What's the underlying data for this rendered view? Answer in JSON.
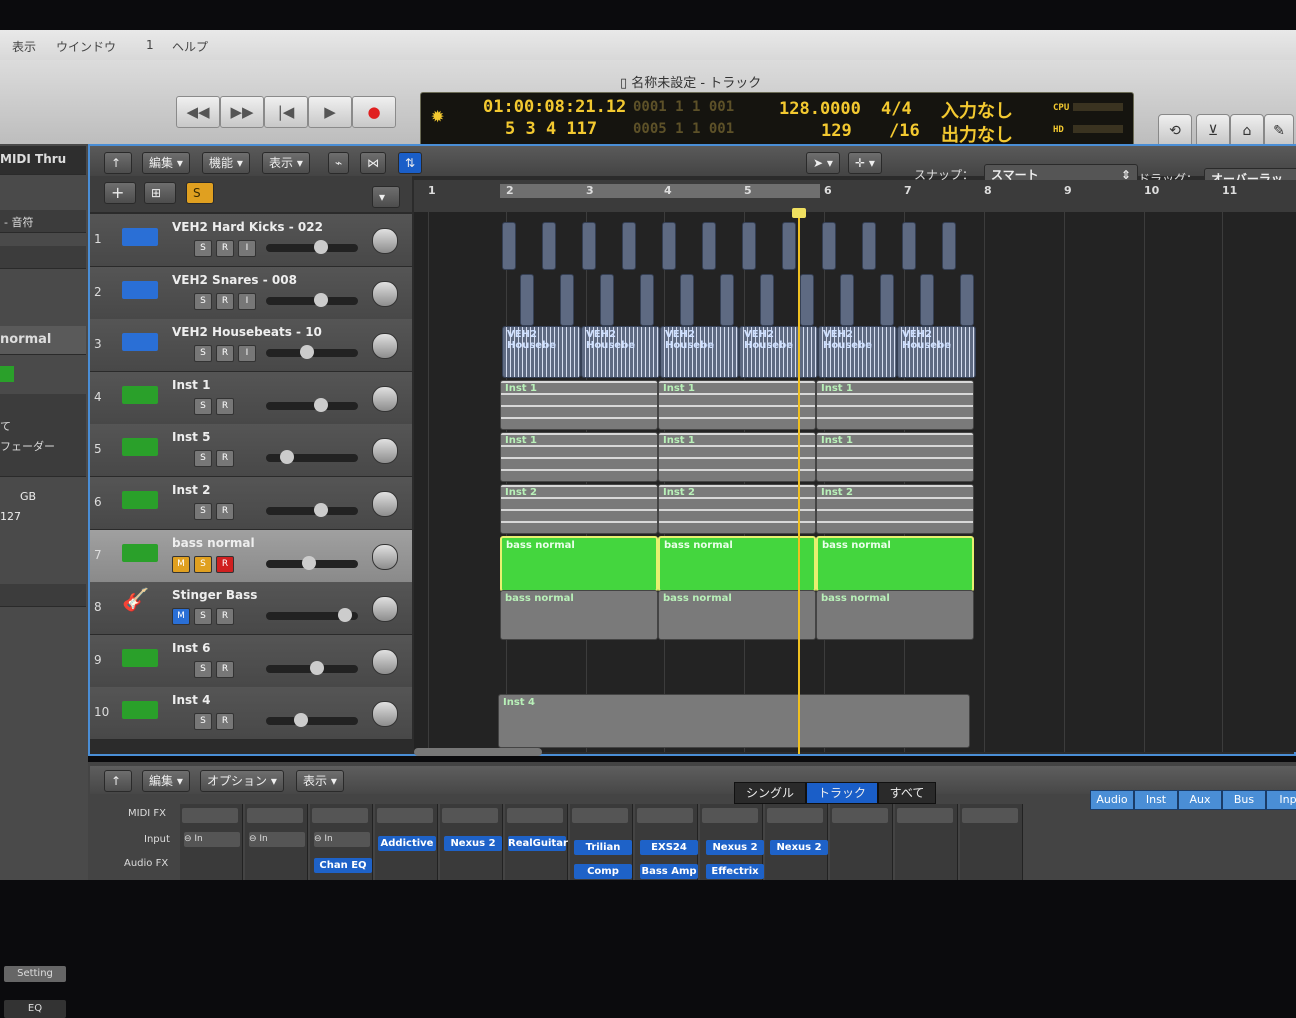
{
  "menubar": {
    "items": [
      "表示",
      "ウインドウ",
      "1",
      "ヘルプ"
    ]
  },
  "window": {
    "title": "名称未設定 - トラック"
  },
  "transport": {
    "rewind": "◀◀",
    "forward": "▶▶",
    "to_start": "|◀",
    "play": "▶",
    "record": "●"
  },
  "lcd": {
    "smpte": "01:00:08:21.12",
    "bars": "5 3 4 117",
    "locator_left": "0001 1 1 001",
    "locator_right": "0005 1 1 001",
    "tempo": "128.0000",
    "tempo2": "129",
    "sig": "4/4",
    "div": "/16",
    "in": "入力なし",
    "out": "出力なし",
    "cpu": "CPU",
    "hd": "HD"
  },
  "inspector": {
    "midi_thru": "MIDI Thru",
    "sound": "- 音符",
    "region_name": "normal",
    "mode": "て",
    "fader": "フェーダー",
    "gb": "GB",
    "velocity": "127",
    "setting": "Setting",
    "eq": "EQ"
  },
  "arrange_menu": {
    "edit": "編集",
    "function": "機能",
    "view": "表示"
  },
  "snap": {
    "label": "スナップ：",
    "value": "スマート"
  },
  "drag": {
    "label": "ドラッグ：",
    "value": "オーバーラッ"
  },
  "tracks": [
    {
      "num": "1",
      "name": "VEH2 Hard Kicks - 022",
      "type": "audio"
    },
    {
      "num": "2",
      "name": "VEH2 Snares - 008",
      "type": "audio"
    },
    {
      "num": "3",
      "name": "VEH2 Housebeats - 10",
      "type": "audio"
    },
    {
      "num": "4",
      "name": "Inst 1",
      "type": "inst"
    },
    {
      "num": "5",
      "name": "Inst 5",
      "type": "inst"
    },
    {
      "num": "6",
      "name": "Inst 2",
      "type": "inst"
    },
    {
      "num": "7",
      "name": "bass normal",
      "type": "inst"
    },
    {
      "num": "8",
      "name": "Stinger Bass",
      "type": "bass"
    },
    {
      "num": "9",
      "name": "Inst 6",
      "type": "inst"
    },
    {
      "num": "10",
      "name": "Inst 4",
      "type": "inst"
    }
  ],
  "mute_label": "M",
  "solo_label": "S",
  "rec_label": "R",
  "input_label": "I",
  "ruler": [
    "1",
    "2",
    "3",
    "4",
    "5",
    "6",
    "7",
    "8",
    "9",
    "10",
    "11"
  ],
  "regions": {
    "housebeats": "VEH2 Housebe",
    "inst1": "Inst 1",
    "inst2": "Inst 2",
    "bass": "bass normal",
    "inst4": "Inst 4"
  },
  "mixer_menu": {
    "edit": "編集",
    "options": "オプション",
    "view": "表示"
  },
  "mixer_tabs": {
    "single": "シングル",
    "track": "トラック",
    "all": "すべて"
  },
  "mixer_filters": [
    "Audio",
    "Inst",
    "Aux",
    "Bus",
    "Inp"
  ],
  "mixer_labels": {
    "midifx": "MIDI FX",
    "input": "Input",
    "audiofx": "Audio FX",
    "in": "In"
  },
  "mixer_plugins": {
    "row1": [
      "Addictive",
      "Nexus 2",
      "RealGuitar",
      "Trilian",
      "EXS24",
      "Nexus 2",
      "Nexus 2"
    ],
    "row2": [
      "Chan EQ",
      "Comp",
      "Bass Amp",
      "Effectrix"
    ]
  }
}
